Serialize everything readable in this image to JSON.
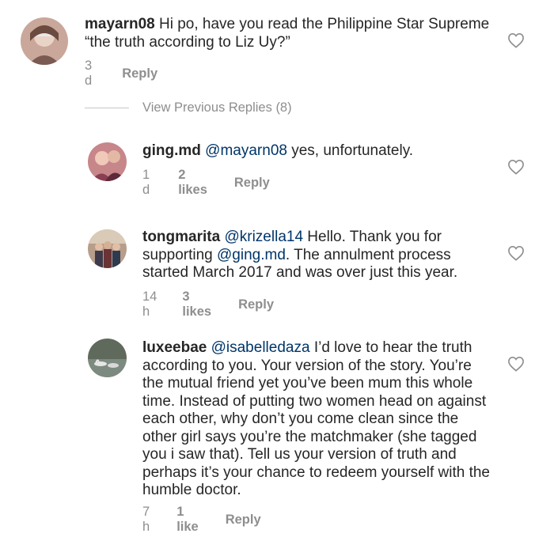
{
  "comments": [
    {
      "username": "mayarn08",
      "mention": "",
      "text": "Hi po, have you read the Philippine Star Supreme “the truth according to Liz Uy?”",
      "time": "3 d",
      "likes": "",
      "reply": "Reply"
    },
    {
      "username": "ging.md",
      "mention": "@mayarn08",
      "text": "yes, unfortunately.",
      "time": "1 d",
      "likes": "2 likes",
      "reply": "Reply"
    },
    {
      "username": "tongmarita",
      "mention": "@krizella14",
      "text_a": "Hello. Thank you for supporting",
      "mention2": "@ging.md",
      "text_b": ". The annulment process started March 2017 and was over just this year.",
      "time": "14 h",
      "likes": "3 likes",
      "reply": "Reply"
    },
    {
      "username": "luxeebae",
      "mention": "@isabelledaza",
      "text": "I’d love to hear the truth according to you. Your version of the story. You’re the mutual friend yet you’ve been mum this whole time. Instead of putting two women head on against each other, why don’t you come clean since the other girl says you’re the matchmaker (she tagged you i saw that). Tell us your version of truth and perhaps it’s your chance to redeem yourself with the humble doctor.",
      "time": "7 h",
      "likes": "1 like",
      "reply": "Reply"
    }
  ],
  "view_previous": "View Previous Replies (8)",
  "icons": {
    "like": "heart-outline-icon"
  },
  "colors": {
    "mention": "#003569",
    "meta": "#8e8e8e",
    "text": "#262626"
  }
}
